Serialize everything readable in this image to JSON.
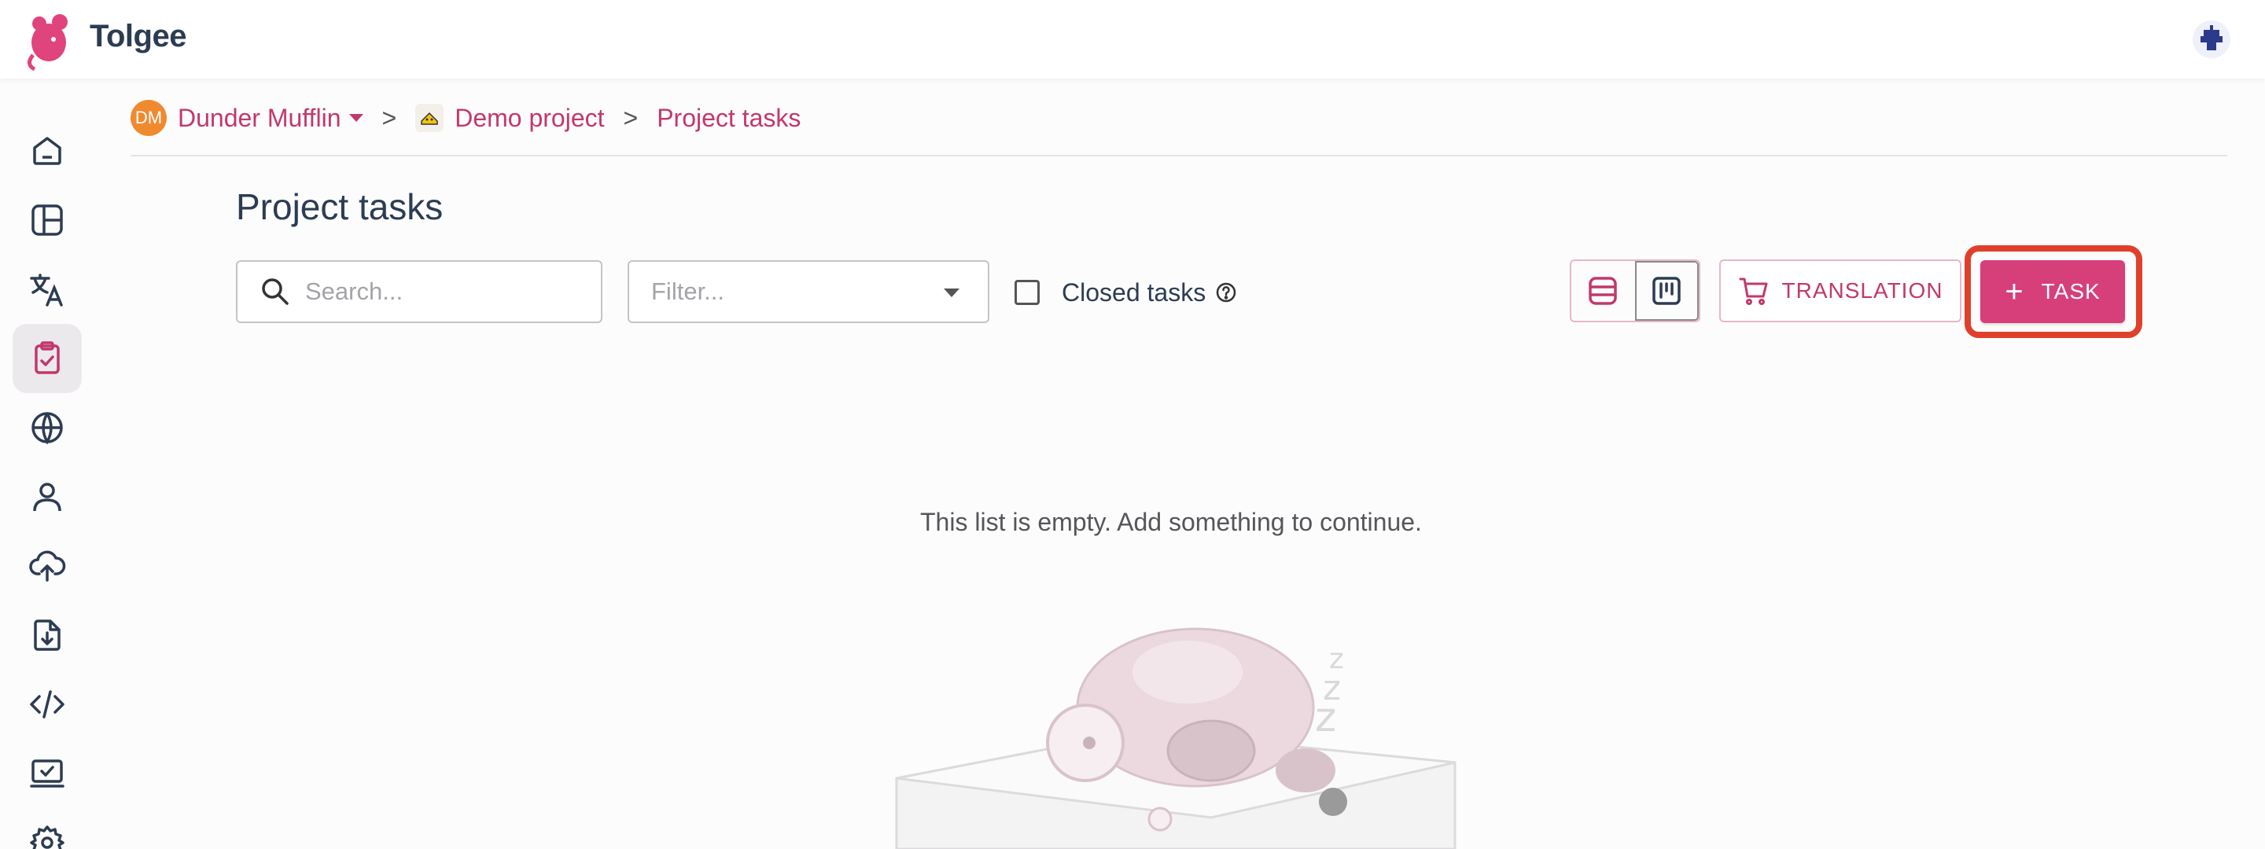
{
  "app": {
    "name": "Tolgee"
  },
  "breadcrumb": {
    "org_initials": "DM",
    "org_name": "Dunder Mufflin",
    "project": "Demo project",
    "current": "Project tasks",
    "separator": ">"
  },
  "page": {
    "title": "Project tasks"
  },
  "toolbar": {
    "search_placeholder": "Search...",
    "filter_placeholder": "Filter...",
    "closed_tasks_label": "Closed tasks",
    "translation_label": "TRANSLATION",
    "task_label": "TASK",
    "task_plus": "+"
  },
  "sidebar": {
    "items": [
      {
        "icon": "home-icon"
      },
      {
        "icon": "dashboard-icon"
      },
      {
        "icon": "translate-icon"
      },
      {
        "icon": "tasks-icon",
        "active": true
      },
      {
        "icon": "globe-icon"
      },
      {
        "icon": "user-icon"
      },
      {
        "icon": "upload-icon"
      },
      {
        "icon": "export-icon"
      },
      {
        "icon": "code-icon"
      },
      {
        "icon": "checklist-icon"
      },
      {
        "icon": "settings-icon"
      }
    ]
  },
  "empty": {
    "message": "This list is empty. Add something to continue."
  },
  "colors": {
    "brand": "#d63f7a",
    "brand_text": "#c2386b",
    "highlight": "#e0402b",
    "org_avatar": "#ef8a2f"
  }
}
